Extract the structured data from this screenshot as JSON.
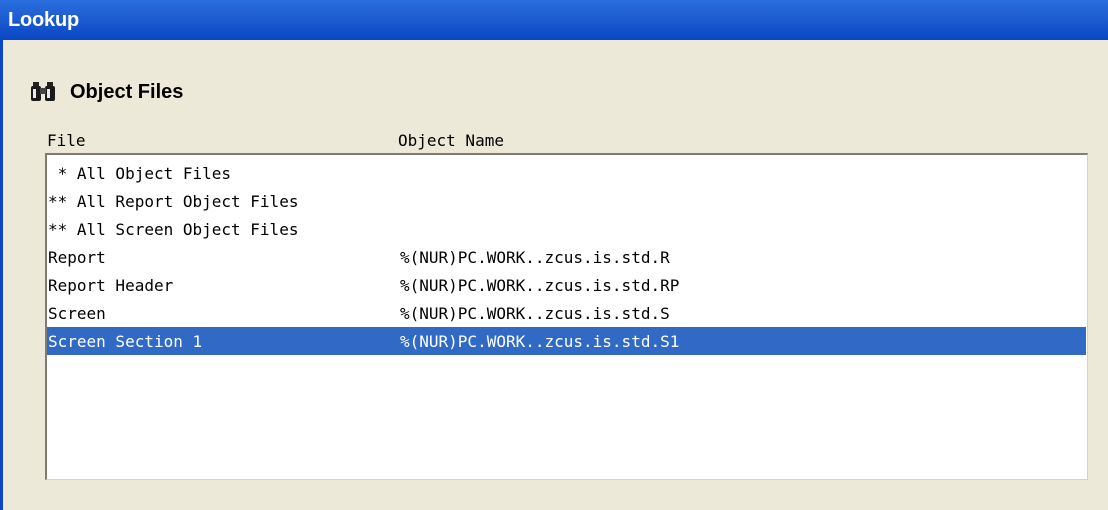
{
  "window": {
    "title": "Lookup"
  },
  "heading": {
    "icon": "binoculars-icon",
    "label": "Object Files"
  },
  "columns": {
    "file": "File",
    "object_name": "Object Name"
  },
  "rows": [
    {
      "file": " * All Object Files",
      "object_name": ""
    },
    {
      "file": "** All Report Object Files",
      "object_name": ""
    },
    {
      "file": "** All Screen Object Files",
      "object_name": ""
    },
    {
      "file": "Report",
      "object_name": "%(NUR)PC.WORK..zcus.is.std.R"
    },
    {
      "file": "Report Header",
      "object_name": "%(NUR)PC.WORK..zcus.is.std.RP"
    },
    {
      "file": "Screen",
      "object_name": "%(NUR)PC.WORK..zcus.is.std.S"
    },
    {
      "file": "Screen Section 1",
      "object_name": "%(NUR)PC.WORK..zcus.is.std.S1",
      "selected": true
    }
  ],
  "colors": {
    "titlebar": "#0a46c4",
    "selection": "#316ac5",
    "dialog_bg": "#ece9d8"
  }
}
